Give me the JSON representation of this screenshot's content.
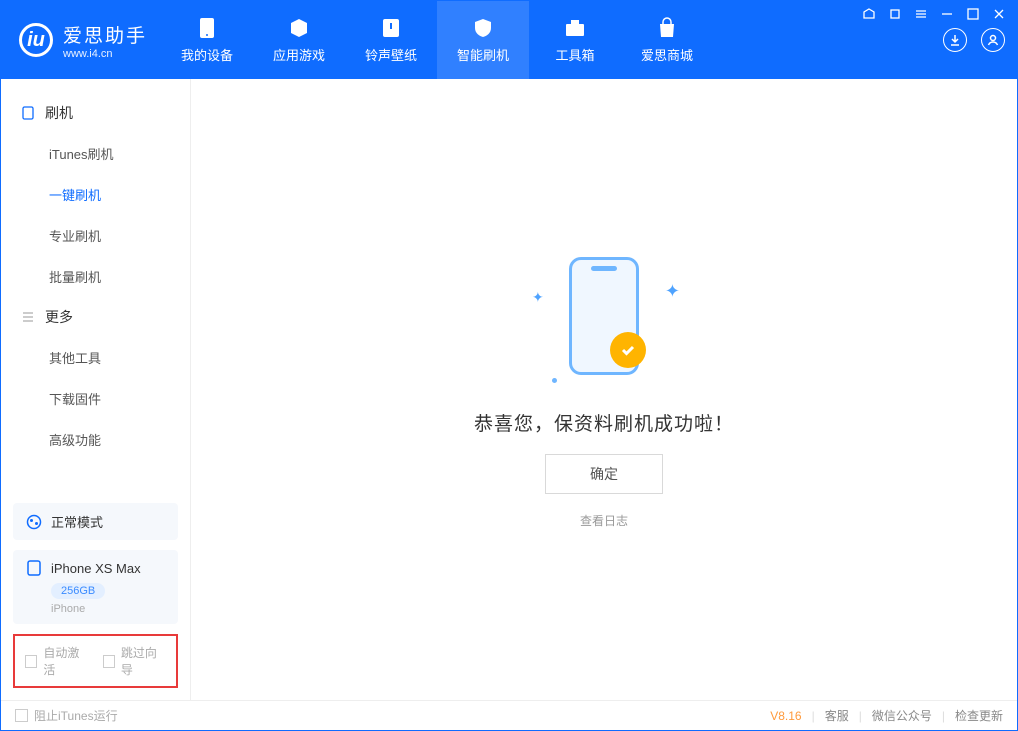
{
  "app": {
    "name": "爱思助手",
    "url": "www.i4.cn"
  },
  "nav": {
    "items": [
      {
        "label": "我的设备"
      },
      {
        "label": "应用游戏"
      },
      {
        "label": "铃声壁纸"
      },
      {
        "label": "智能刷机"
      },
      {
        "label": "工具箱"
      },
      {
        "label": "爱思商城"
      }
    ]
  },
  "sidebar": {
    "sections": [
      {
        "title": "刷机",
        "items": [
          "iTunes刷机",
          "一键刷机",
          "专业刷机",
          "批量刷机"
        ]
      },
      {
        "title": "更多",
        "items": [
          "其他工具",
          "下载固件",
          "高级功能"
        ]
      }
    ],
    "mode_label": "正常模式",
    "device_name": "iPhone XS Max",
    "device_storage": "256GB",
    "device_type": "iPhone",
    "cb_auto_activate": "自动激活",
    "cb_skip_guide": "跳过向导"
  },
  "main": {
    "success_text": "恭喜您，保资料刷机成功啦！",
    "ok_label": "确定",
    "view_log": "查看日志"
  },
  "footer": {
    "block_itunes": "阻止iTunes运行",
    "version": "V8.16",
    "links": [
      "客服",
      "微信公众号",
      "检查更新"
    ]
  }
}
